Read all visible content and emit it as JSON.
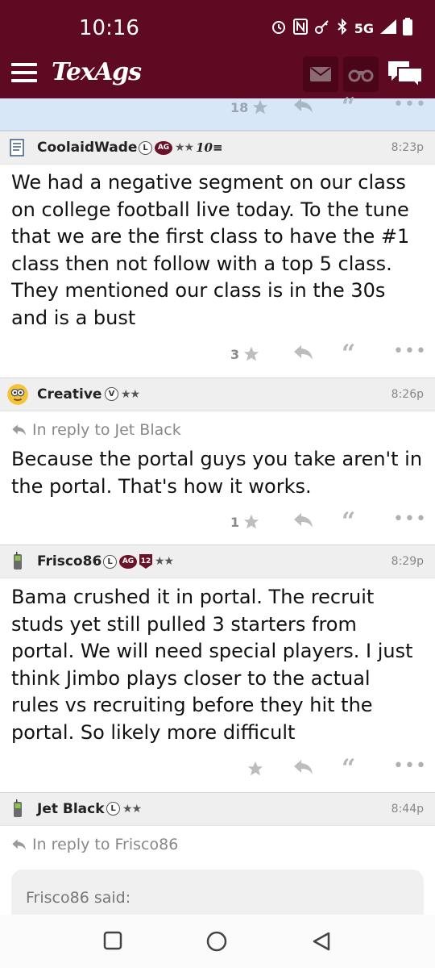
{
  "status": {
    "time": "10:16",
    "network": "5G"
  },
  "app": {
    "logo": "TexAgs"
  },
  "top_row": {
    "like_count": "18"
  },
  "posts": [
    {
      "username": "CoolaidWade",
      "badges": {
        "letter": "L",
        "ag": "AG",
        "stars": "★★",
        "extra": "10≡"
      },
      "time": "8:23p",
      "body": "We had a negative segment on our class on college football live today. To the tune that we are the first class to have the #1 class then not follow with a top 5 class. They mentioned our class is in the 30s and is a bust",
      "like_count": "3"
    },
    {
      "username": "Creative",
      "badges": {
        "letter": "V",
        "stars": "★★"
      },
      "time": "8:26p",
      "reply_to": "In reply to Jet Black",
      "body": "Because the portal guys you take aren't in the portal. That's how it works.",
      "like_count": "1"
    },
    {
      "username": "Frisco86",
      "badges": {
        "letter": "L",
        "ag": "AG",
        "shield": "12",
        "stars": "★★"
      },
      "time": "8:29p",
      "body": "Bama crushed it in portal. The recruit studs yet still pulled 3 starters from portal. We will need special players. I just think Jimbo plays closer to the actual rules vs recruiting before they hit the portal. So likely more difficult",
      "like_count": ""
    },
    {
      "username": "Jet Black",
      "badges": {
        "letter": "L",
        "stars": "★★"
      },
      "time": "8:44p",
      "reply_to": "In reply to Frisco86",
      "quote_author": "Frisco86 said:"
    }
  ],
  "icons": {
    "menu": "hamburger-icon",
    "mail": "mail-icon",
    "binoculars": "binoculars-icon",
    "chat": "chat-bubbles-icon",
    "star": "star-icon",
    "reply": "reply-arrow-icon",
    "quote": "quote-icon",
    "more": "more-dots-icon"
  },
  "colors": {
    "brand": "#5d0a22",
    "header_bg": "#efefef",
    "highlight": "#d8e7f7"
  }
}
